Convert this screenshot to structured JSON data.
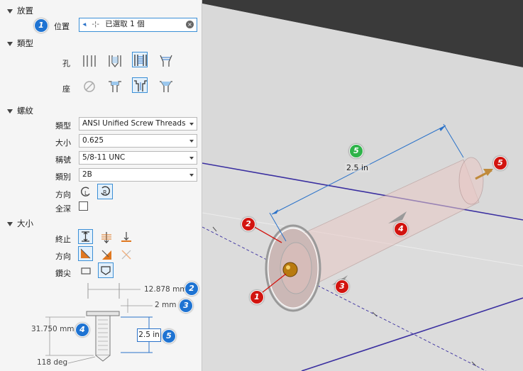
{
  "panel": {
    "placement": {
      "header": "放置",
      "position_label": "位置",
      "position_value": "已選取 1 個",
      "callout": "1"
    },
    "type": {
      "header": "類型",
      "hole_label": "孔",
      "seat_label": "座"
    },
    "thread": {
      "header": "螺紋",
      "type_label": "類型",
      "type_value": "ANSI Unified Screw Threads",
      "size_label": "大小",
      "size_value": "0.625",
      "designation_label": "稱號",
      "designation_value": "5/8-11 UNC",
      "class_label": "類別",
      "class_value": "2B",
      "direction_label": "方向",
      "full_depth_label": "全深"
    },
    "size": {
      "header": "大小",
      "termination_label": "終止",
      "direction_label": "方向",
      "drill_point_label": "鑽尖"
    },
    "diagram": {
      "dim_diameter": "12.878 mm",
      "dim_depth_small": "2 mm",
      "dim_length": "31.750 mm",
      "dim_thread_depth": "2.5 in",
      "dim_angle": "118 deg",
      "callout_2": "2",
      "callout_3": "3",
      "callout_4": "4",
      "callout_5": "5"
    }
  },
  "viewport": {
    "dimension_label": "2.5 in",
    "callouts": [
      "1",
      "2",
      "3",
      "4",
      "5"
    ],
    "green_callout": "5"
  },
  "colors": {
    "accent_blue": "#1e73d2",
    "callout_red": "#d2140f",
    "callout_green": "#2fb34a",
    "edge_purple": "#3a2fa0"
  }
}
